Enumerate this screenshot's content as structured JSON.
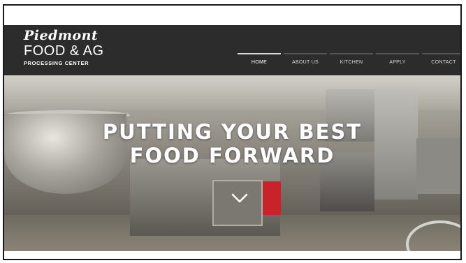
{
  "logo": {
    "line1": "Piedmont",
    "line2": "FOOD & AG",
    "line3": "PROCESSING CENTER"
  },
  "nav": {
    "items": [
      {
        "label": "HOME",
        "active": true
      },
      {
        "label": "ABOUT US",
        "active": false
      },
      {
        "label": "KITCHEN",
        "active": false
      },
      {
        "label": "APPLY",
        "active": false
      },
      {
        "label": "CONTACT",
        "active": false
      }
    ]
  },
  "hero": {
    "title_line1": "PUTTING YOUR BEST",
    "title_line2": "FOOD FORWARD",
    "scroll_icon": "chevron-down-icon"
  },
  "colors": {
    "header_bg": "#2c2c2c",
    "text": "#ffffff",
    "accent_red": "#c8222b"
  }
}
